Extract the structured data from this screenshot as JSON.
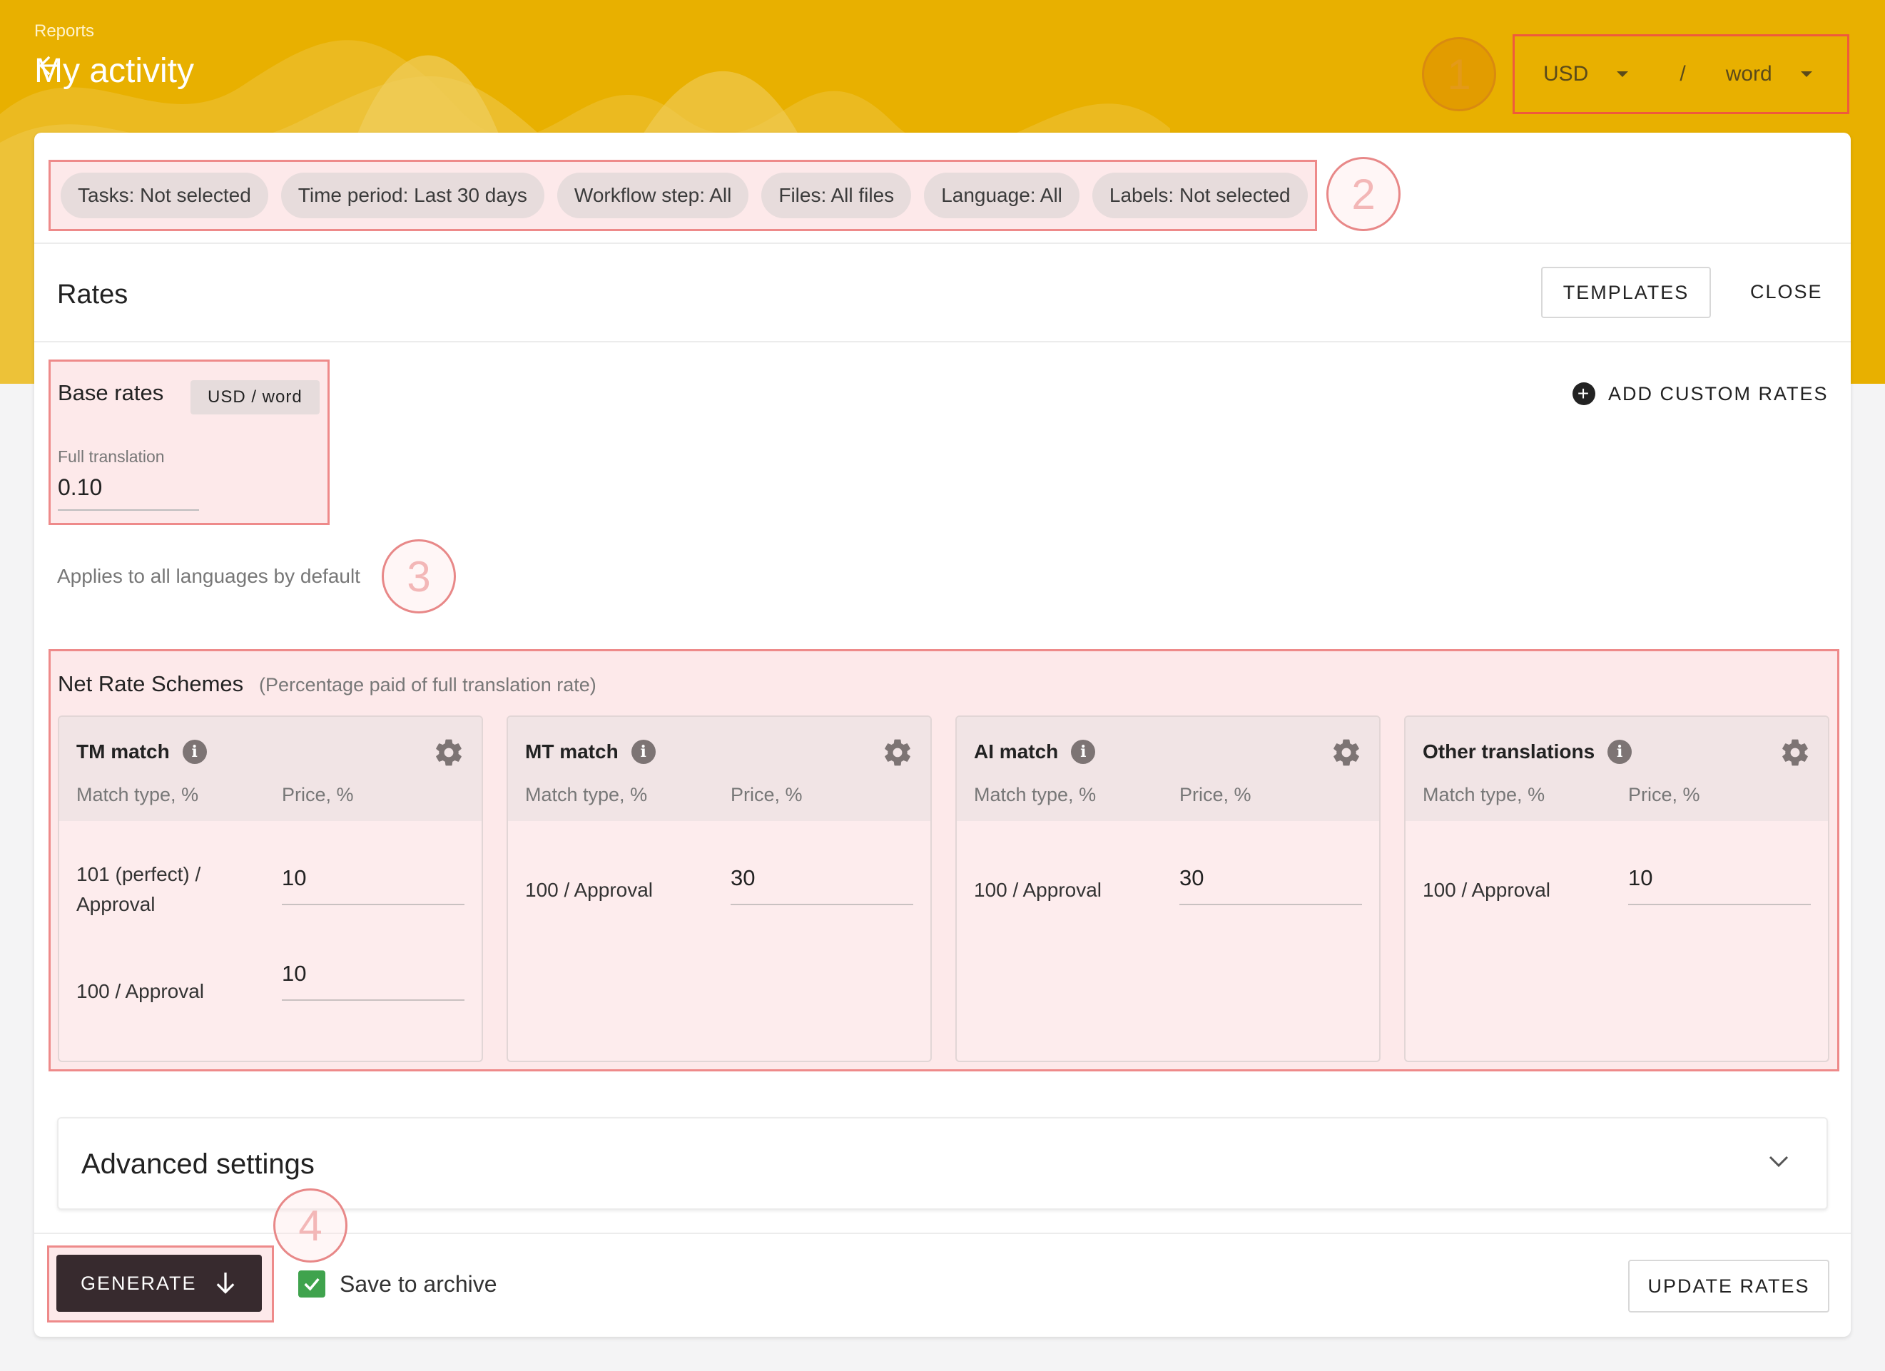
{
  "header": {
    "breadcrumb": "Reports",
    "title": "My activity",
    "currency": "USD",
    "separator": "/",
    "unit": "word"
  },
  "markers": [
    "1",
    "2",
    "3",
    "4"
  ],
  "filters": [
    "Tasks: Not selected",
    "Time period: Last 30 days",
    "Workflow step: All",
    "Files: All files",
    "Language: All",
    "Labels: Not selected"
  ],
  "rates": {
    "title": "Rates",
    "templates_label": "TEMPLATES",
    "close_label": "CLOSE",
    "add_custom_label": "ADD CUSTOM RATES"
  },
  "base_rates": {
    "title": "Base rates",
    "badge": "USD / word",
    "field_label": "Full translation",
    "field_value": "0.10",
    "applies_text": "Applies to all languages by default"
  },
  "net_rates": {
    "title": "Net Rate Schemes",
    "subtitle": "(Percentage paid of full translation rate)",
    "col_match": "Match type, %",
    "col_price": "Price, %",
    "schemes": [
      {
        "title": "TM match",
        "rows": [
          {
            "type": "101 (perfect) /\nApproval",
            "price": "10"
          },
          {
            "type": "100 / Approval",
            "price": "10"
          }
        ]
      },
      {
        "title": "MT match",
        "rows": [
          {
            "type": "100 / Approval",
            "price": "30"
          }
        ]
      },
      {
        "title": "AI match",
        "rows": [
          {
            "type": "100 / Approval",
            "price": "30"
          }
        ]
      },
      {
        "title": "Other translations",
        "rows": [
          {
            "type": "100 / Approval",
            "price": "10"
          }
        ]
      }
    ]
  },
  "advanced": {
    "title": "Advanced settings"
  },
  "footer": {
    "generate_label": "GENERATE",
    "archive_label": "Save to archive",
    "update_label": "UPDATE RATES"
  },
  "colors": {
    "header_bg": "#e8b000",
    "highlight_border": "#ee8a8a",
    "highlight_fill": "#fde9ea",
    "primary_button": "#372a2e",
    "checkbox": "#3fa34d"
  }
}
